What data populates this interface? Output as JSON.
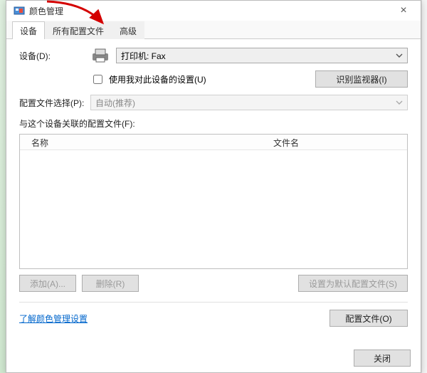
{
  "window": {
    "title": "颜色管理",
    "close_glyph": "×"
  },
  "tabs": {
    "device": "设备",
    "all_profiles": "所有配置文件",
    "advanced": "高级"
  },
  "labels": {
    "device": "设备(D):",
    "profile_select": "配置文件选择(P):",
    "assoc_profiles": "与这个设备关联的配置文件(F):"
  },
  "device_dropdown": {
    "value": "打印机: Fax"
  },
  "use_my_settings": {
    "label": "使用我对此设备的设置(U)",
    "checked": false
  },
  "identify_btn": "识别监视器(I)",
  "profile_dropdown": {
    "value": "自动(推荐)"
  },
  "list": {
    "col_name": "名称",
    "col_file": "文件名"
  },
  "buttons": {
    "add": "添加(A)...",
    "remove": "删除(R)",
    "set_default": "设置为默认配置文件(S)",
    "profiles": "配置文件(O)",
    "close": "关闭"
  },
  "link": {
    "learn": "了解颜色管理设置"
  }
}
